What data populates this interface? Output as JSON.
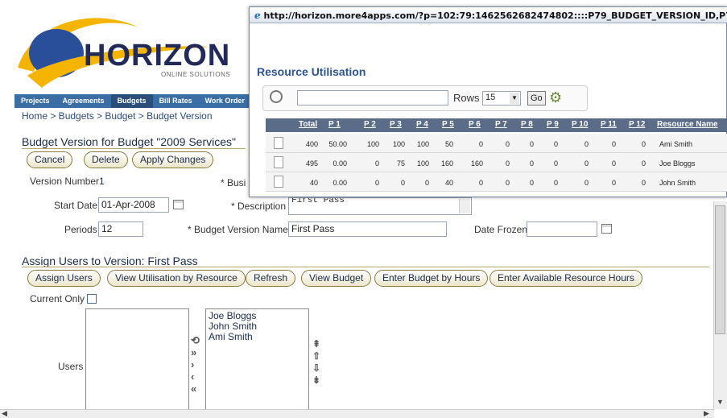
{
  "colors": {
    "accent": "#2c5494",
    "nav_bar": "#3a6ea5",
    "table_header": "#5a6c88"
  },
  "logo": {
    "name": "HORIZON",
    "subtitle": "ONLINE SOLUTIONS"
  },
  "nav": {
    "items": [
      "Projects",
      "Agreements",
      "Budgets",
      "Bill Rates",
      "Work Order"
    ],
    "active": "Budgets"
  },
  "breadcrumb": "Home > Budgets > Budget > Budget Version",
  "page_title": "Budget Version for Budget \"2009 Services\"",
  "buttons": {
    "cancel": "Cancel",
    "delete": "Delete",
    "apply": "Apply Changes"
  },
  "form": {
    "version_number_label": "Version Number",
    "version_number_value": "1",
    "business_label": "* Busi",
    "start_date_label": "Start Date",
    "start_date_value": "01-Apr-2008",
    "description_label": "* Description",
    "description_value": "First Pass",
    "periods_label": "Periods",
    "periods_value": "12",
    "budget_version_name_label": "* Budget Version Name",
    "budget_version_name_value": "First Pass",
    "date_frozen_label": "Date Frozen",
    "date_frozen_value": ""
  },
  "assign": {
    "title": "Assign Users to Version: First Pass",
    "buttons": [
      "Assign Users",
      "View Utilisation by Resource",
      "Refresh",
      "View Budget",
      "Enter Budget by Hours",
      "Enter Available Resource Hours"
    ],
    "current_only_label": "Current Only",
    "users_label": "Users",
    "available_users": [],
    "selected_users": [
      "Joe Bloggs",
      "John Smith",
      "Ami Smith"
    ]
  },
  "popup": {
    "url": "http://horizon.more4apps.com/?p=102:79:1462562682474802::::P79_BUDGET_VERSION_ID,P79_START_",
    "title": "Resource Utilisation",
    "search_value": "",
    "rows_label": "Rows",
    "rows_value": "15",
    "go_label": "Go",
    "columns": [
      "Total",
      "P 1",
      "P 2",
      "P 3",
      "P 4",
      "P 5",
      "P 6",
      "P 7",
      "P 8",
      "P 9",
      "P 10",
      "P 11",
      "P 12",
      "Resource Name"
    ],
    "rows": [
      [
        "400",
        "50.00",
        "100",
        "100",
        "100",
        "50",
        "0",
        "0",
        "0",
        "0",
        "0",
        "0",
        "0",
        "Ami Smith"
      ],
      [
        "495",
        "0.00",
        "0",
        "75",
        "100",
        "160",
        "160",
        "0",
        "0",
        "0",
        "0",
        "0",
        "0",
        "Joe Bloggs"
      ],
      [
        "40",
        "0.00",
        "0",
        "0",
        "0",
        "40",
        "0",
        "0",
        "0",
        "0",
        "0",
        "0",
        "0",
        "John Smith"
      ]
    ]
  }
}
